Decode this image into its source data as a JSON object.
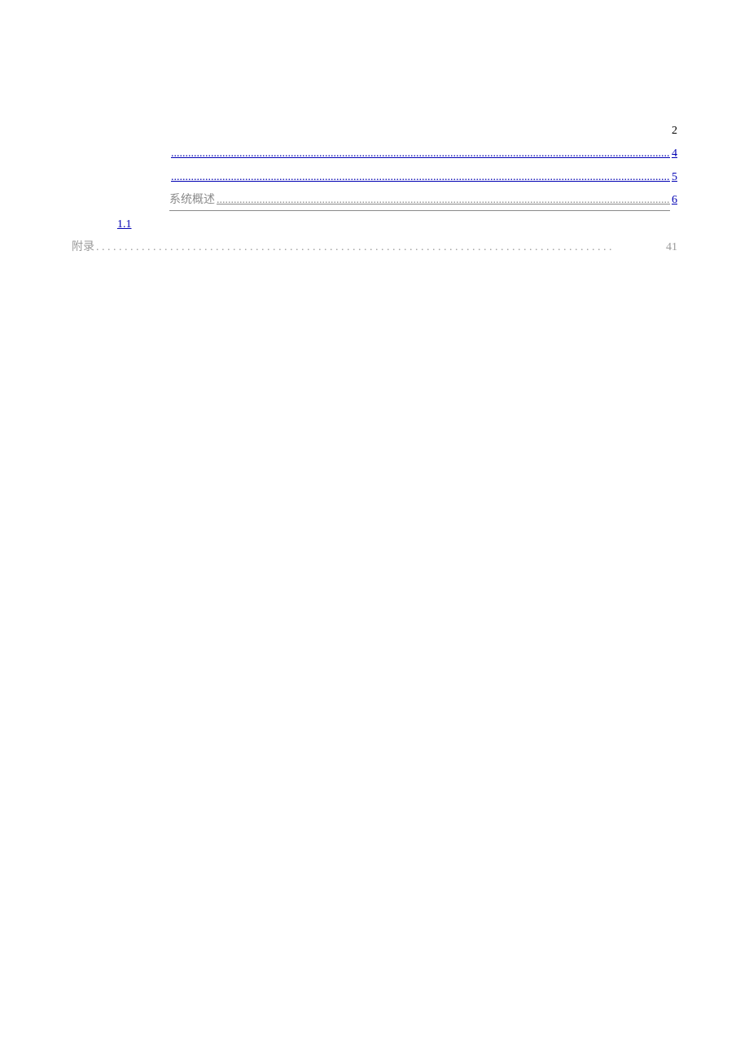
{
  "toc": [
    {
      "indent": 3,
      "prefix": "",
      "label": "",
      "leader": "none",
      "page": "2",
      "labelClass": "",
      "numClass": "serif-times"
    },
    {
      "indent": 2,
      "prefix": "",
      "label": "",
      "leader": "dots",
      "page": "4",
      "labelClass": "",
      "numClass": "serif-times link"
    },
    {
      "indent": 2,
      "prefix": "",
      "label": "",
      "leader": "dots",
      "page": "5",
      "labelClass": "",
      "numClass": "serif-times link"
    },
    {
      "indent": 2,
      "prefix": "",
      "label": "系统概述",
      "leader": "dots",
      "page": "6",
      "labelClass": "dim-underline",
      "numClass": "serif-times link"
    },
    {
      "indent": 1,
      "prefix": "1.1",
      "label": "",
      "leader": "none",
      "page": "",
      "labelClass": "",
      "numClass": ""
    },
    {
      "indent": 0,
      "prefix": "",
      "label": "附录",
      "leader": "spaced",
      "page": "41",
      "labelClass": "gray",
      "numClass": "serif-times gray"
    }
  ],
  "leaders": {
    "dots": "..............................................................................................................................................................................................................................................................",
    "spaced": ". . . . . . . . . . . . . . . . . . . . . . . . . . . . . . . . . . . . . . . . . . . . . . . . . . . . . . . . . . . . . . . . . . . . . . . . . . . . . . . . . . . . . . . . . . . "
  }
}
